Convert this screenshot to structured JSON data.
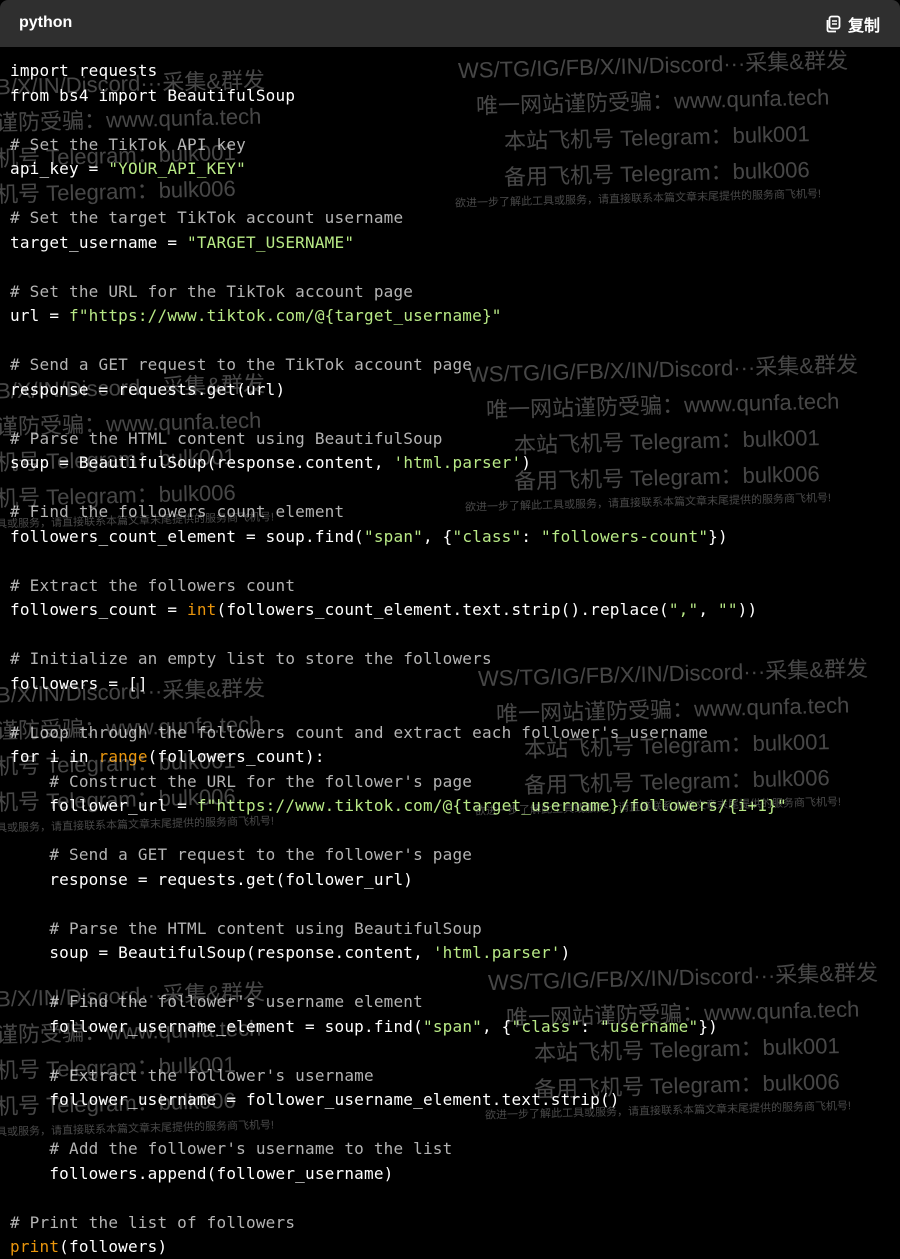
{
  "header": {
    "language": "python",
    "copy_label": "复制"
  },
  "code_lines": [
    [
      [
        "",
        "import requests"
      ]
    ],
    [
      [
        "",
        "from bs4 import BeautifulSoup"
      ]
    ],
    [],
    [
      [
        "c",
        "# Set the TikTok API key"
      ]
    ],
    [
      [
        "",
        "api_key = "
      ],
      [
        "s",
        "\"YOUR_API_KEY\""
      ]
    ],
    [],
    [
      [
        "c",
        "# Set the target TikTok account username"
      ]
    ],
    [
      [
        "",
        "target_username = "
      ],
      [
        "s",
        "\"TARGET_USERNAME\""
      ]
    ],
    [],
    [
      [
        "c",
        "# Set the URL for the TikTok account page"
      ]
    ],
    [
      [
        "",
        "url = "
      ],
      [
        "s",
        "f\"https://www.tiktok.com/@{target_username}\""
      ]
    ],
    [],
    [
      [
        "c",
        "# Send a GET request to the TikTok account page"
      ]
    ],
    [
      [
        "",
        "response = requests.get(url)"
      ]
    ],
    [],
    [
      [
        "c",
        "# Parse the HTML content using BeautifulSoup"
      ]
    ],
    [
      [
        "",
        "soup = BeautifulSoup(response.content, "
      ],
      [
        "s",
        "'html.parser'"
      ],
      [
        "",
        ")"
      ]
    ],
    [],
    [
      [
        "c",
        "# Find the followers count element"
      ]
    ],
    [
      [
        "",
        "followers_count_element = soup.find("
      ],
      [
        "s",
        "\"span\""
      ],
      [
        "",
        ", {"
      ],
      [
        "s",
        "\"class\""
      ],
      [
        "",
        ": "
      ],
      [
        "s",
        "\"followers-count\""
      ],
      [
        "",
        "})"
      ]
    ],
    [],
    [
      [
        "c",
        "# Extract the followers count"
      ]
    ],
    [
      [
        "",
        "followers_count = "
      ],
      [
        "b",
        "int"
      ],
      [
        "",
        "(followers_count_element.text.strip().replace("
      ],
      [
        "s",
        "\",\""
      ],
      [
        "",
        ", "
      ],
      [
        "s",
        "\"\""
      ],
      [
        "",
        "))"
      ]
    ],
    [],
    [
      [
        "c",
        "# Initialize an empty list to store the followers"
      ]
    ],
    [
      [
        "",
        "followers = []"
      ]
    ],
    [],
    [
      [
        "c",
        "# Loop through the followers count and extract each follower's username"
      ]
    ],
    [
      [
        "",
        "for i in "
      ],
      [
        "b",
        "range"
      ],
      [
        "",
        "(followers_count):"
      ]
    ],
    [
      [
        "c",
        "    # Construct the URL for the follower's page"
      ]
    ],
    [
      [
        "",
        "    follower_url = "
      ],
      [
        "s",
        "f\"https://www.tiktok.com/@{target_username}/followers/{i+1}\""
      ]
    ],
    [],
    [
      [
        "c",
        "    # Send a GET request to the follower's page"
      ]
    ],
    [
      [
        "",
        "    response = requests.get(follower_url)"
      ]
    ],
    [],
    [
      [
        "c",
        "    # Parse the HTML content using BeautifulSoup"
      ]
    ],
    [
      [
        "",
        "    soup = BeautifulSoup(response.content, "
      ],
      [
        "s",
        "'html.parser'"
      ],
      [
        "",
        ")"
      ]
    ],
    [],
    [
      [
        "c",
        "    # Find the follower's username element"
      ]
    ],
    [
      [
        "",
        "    follower_username_element = soup.find("
      ],
      [
        "s",
        "\"span\""
      ],
      [
        "",
        ", {"
      ],
      [
        "s",
        "\"class\""
      ],
      [
        "",
        ": "
      ],
      [
        "s",
        "\"username\""
      ],
      [
        "",
        "})"
      ]
    ],
    [],
    [
      [
        "c",
        "    # Extract the follower's username"
      ]
    ],
    [
      [
        "",
        "    follower_username = follower_username_element.text.strip()"
      ]
    ],
    [],
    [
      [
        "c",
        "    # Add the follower's username to the list"
      ]
    ],
    [
      [
        "",
        "    followers.append(follower_username)"
      ]
    ],
    [],
    [
      [
        "c",
        "# Print the list of followers"
      ]
    ],
    [
      [
        "b",
        "print"
      ],
      [
        "",
        "(followers)"
      ]
    ]
  ],
  "watermark": {
    "line1": "WS/TG/IG/FB/X/IN/Discord···采集&群发",
    "line2": "唯一网站谨防受骗：www.qunfa.tech",
    "line3": "本站飞机号 Telegram：bulk001",
    "line4": "备用飞机号 Telegram：bulk006",
    "line5": "欲进一步了解此工具或服务，请直接联系本篇文章末尾提供的服务商飞机号!",
    "left1": "B/X/IN/Discord···采集&群发",
    "left2": "谨防受骗：www.qunfa.tech",
    "left3": "机号 Telegram：bulk001",
    "left4": "机号 Telegram：bulk006",
    "left5": "具或服务，请直接联系本篇文章末尾提供的服务商飞机号!"
  }
}
